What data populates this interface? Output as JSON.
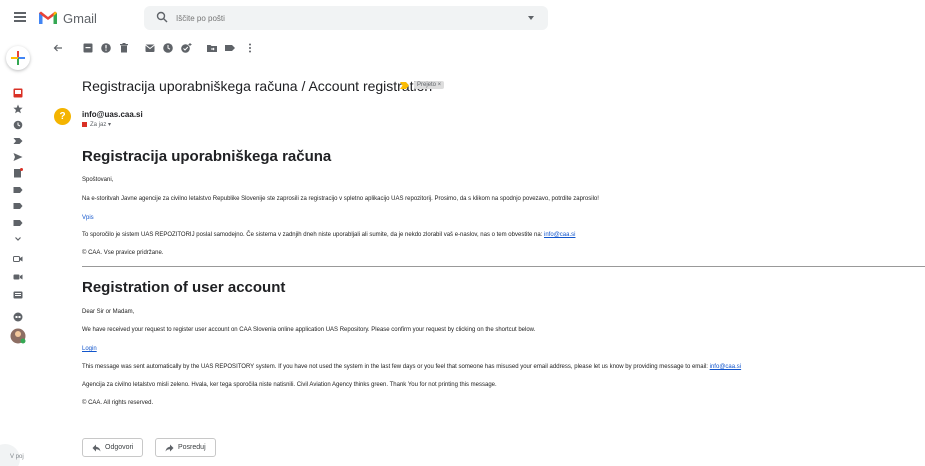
{
  "app": {
    "brand": "Gmail"
  },
  "search": {
    "placeholder": "Iščite po pošti"
  },
  "message": {
    "subject": "Registracija uporabniškega računa / Account registration",
    "label": "Prejeto ×",
    "sender": "info@uas.caa.si",
    "to_line": "Za jaz ▾",
    "avatar_letter": "?"
  },
  "body_sl": {
    "heading": "Registracija uporabniškega računa",
    "greeting": "Spoštovani,",
    "para1": "Na e-storitvah Javne agencije za civilno letalstvo Republike Slovenije ste zaprosili za registracijo v spletno aplikacijo UAS repozitorij. Prosimo, da s klikom na spodnjo povezavo, potrdite zaprosilo!",
    "link": "Vpis",
    "para2": "To sporočilo je sistem UAS REPOZITORIJ poslal samodejno. Če sistema v zadnjih dneh niste uporabljali ali sumite, da je nekdo zlorabil vaš e-naslov, nas o tem obvestite na:",
    "email": "info@caa.si",
    "copyright": "© CAA. Vse pravice pridržane."
  },
  "body_en": {
    "heading": "Registration of user account",
    "greeting": "Dear Sir or Madam,",
    "para1": "We have received your request to register user account on CAA Slovenia online application UAS Repository. Please confirm your request by clicking on the shortcut below.",
    "link": "Login",
    "para2": "This message was sent automatically by the UAS REPOSITORY system. If you have not used the system in the last few days or you feel that someone has misused your email address, please let us know by providing message to email:",
    "email": "info@caa.si",
    "para3": "Agencija za civilno letalstvo misli zeleno. Hvala, ker tega sporočila niste natisnili. Civil Aviation Agency thinks green. Thank You for not printing this message.",
    "copyright": "© CAA. All rights reserved."
  },
  "actions": {
    "reply": "Odgovori",
    "forward": "Posreduj"
  },
  "rail": {
    "bottom_text": "V poj"
  },
  "colors": {
    "red": "#ea4335",
    "blue": "#4285f4",
    "yellow": "#fbbc04",
    "green": "#34a853",
    "link": "#1155cc"
  }
}
